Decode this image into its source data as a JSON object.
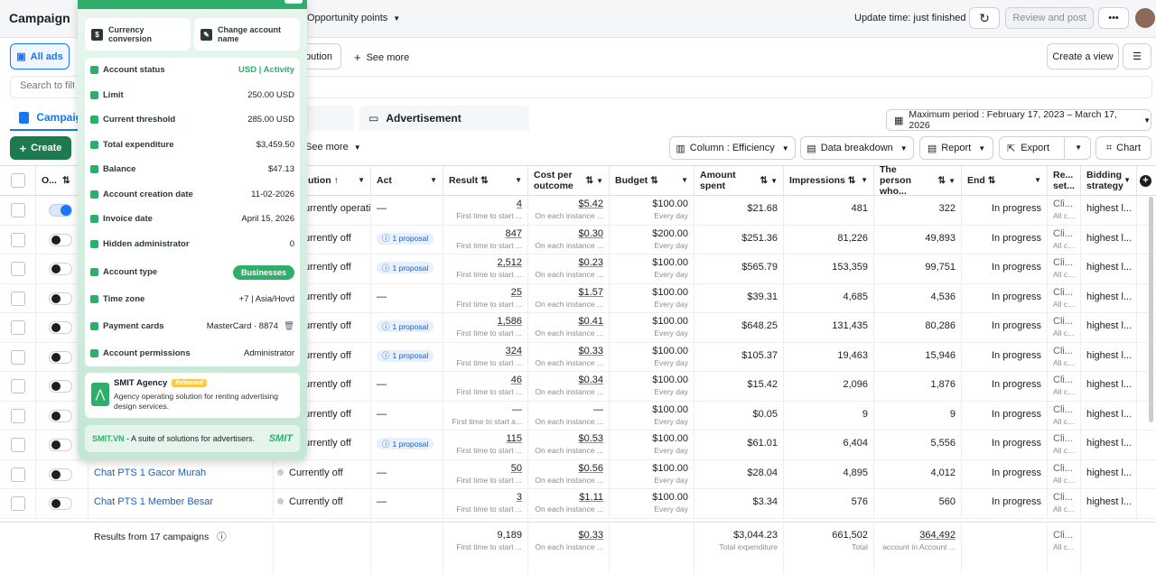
{
  "header": {
    "title": "Campaign",
    "dropdown": "Opportunity points",
    "update_time": "Update time: just finished",
    "review_label": "Review and post"
  },
  "tabs_row": {
    "all_ads": "All ads",
    "distribution_partial": "bution",
    "see_more": "See more",
    "create_view": "Create a view"
  },
  "search": {
    "placeholder": "Search to filte"
  },
  "level_tabs": {
    "campaign": "Campaig",
    "advertisement": "Advertisement"
  },
  "date_range": "Maximum period : February 17, 2023 – March 17, 2026",
  "toolbar": {
    "create": "Create",
    "see_more": "See more",
    "column": "Column : Efficiency",
    "breakdown": "Data breakdown",
    "report": "Report",
    "export": "Export",
    "chart": "Chart"
  },
  "columns": {
    "onoff": "O...",
    "distribution": "ution",
    "act": "Act",
    "result": "Result",
    "cost_per_outcome": "Cost per outcome",
    "budget": "Budget",
    "amount_spent": "Amount spent",
    "impressions": "Impressions",
    "person_who": "The person who...",
    "end": "End",
    "results_set": "Re... set...",
    "bidding": "Bidding strategy"
  },
  "rows": [
    {
      "toggle": "on",
      "status": "urrently operatin",
      "status_dot": "",
      "act": "—",
      "result": "4",
      "cost": "$5.42",
      "budget": "$100.00",
      "spent": "$21.68",
      "impressions": "481",
      "reach": "322",
      "end": "In progress",
      "rs": "Cli...",
      "bid": "highest l..."
    },
    {
      "toggle": "off",
      "status": "urrently off",
      "status_dot": "",
      "act": "1 proposal",
      "result": "847",
      "cost": "$0.30",
      "budget": "$200.00",
      "spent": "$251.36",
      "impressions": "81,226",
      "reach": "49,893",
      "end": "In progress",
      "rs": "Cli...",
      "bid": "highest l..."
    },
    {
      "toggle": "off",
      "status": "urrently off",
      "status_dot": "",
      "act": "1 proposal",
      "result": "2,512",
      "cost": "$0.23",
      "budget": "$100.00",
      "spent": "$565.79",
      "impressions": "153,359",
      "reach": "99,751",
      "end": "In progress",
      "rs": "Cli...",
      "bid": "highest l..."
    },
    {
      "toggle": "off",
      "status": "urrently off",
      "status_dot": "",
      "act": "—",
      "result": "25",
      "cost": "$1.57",
      "budget": "$100.00",
      "spent": "$39.31",
      "impressions": "4,685",
      "reach": "4,536",
      "end": "In progress",
      "rs": "Cli...",
      "bid": "highest l..."
    },
    {
      "toggle": "off",
      "status": "urrently off",
      "status_dot": "",
      "act": "1 proposal",
      "result": "1,586",
      "cost": "$0.41",
      "budget": "$100.00",
      "spent": "$648.25",
      "impressions": "131,435",
      "reach": "80,286",
      "end": "In progress",
      "rs": "Cli...",
      "bid": "highest l..."
    },
    {
      "toggle": "off",
      "status": "urrently off",
      "status_dot": "",
      "act": "1 proposal",
      "result": "324",
      "cost": "$0.33",
      "budget": "$100.00",
      "spent": "$105.37",
      "impressions": "19,463",
      "reach": "15,946",
      "end": "In progress",
      "rs": "Cli...",
      "bid": "highest l..."
    },
    {
      "toggle": "off",
      "status": "urrently off",
      "status_dot": "",
      "act": "—",
      "result": "46",
      "cost": "$0.34",
      "budget": "$100.00",
      "spent": "$15.42",
      "impressions": "2,096",
      "reach": "1,876",
      "end": "In progress",
      "rs": "Cli...",
      "bid": "highest l..."
    },
    {
      "toggle": "off",
      "status": "urrently off",
      "status_dot": "",
      "act": "—",
      "result": "—",
      "cost": "—",
      "budget": "$100.00",
      "spent": "$0.05",
      "impressions": "9",
      "reach": "9",
      "end": "In progress",
      "rs": "Cli...",
      "bid": "highest l..."
    },
    {
      "toggle": "off",
      "status": "urrently off",
      "status_dot": "",
      "act": "1 proposal",
      "result": "115",
      "cost": "$0.53",
      "budget": "$100.00",
      "spent": "$61.01",
      "impressions": "6,404",
      "reach": "5,556",
      "end": "In progress",
      "rs": "Cli...",
      "bid": "highest l..."
    },
    {
      "toggle": "off",
      "name": "Chat PTS 1 Gacor Murah",
      "status": "Currently off",
      "status_dot": "dot",
      "act": "—",
      "result": "50",
      "cost": "$0.56",
      "budget": "$100.00",
      "spent": "$28.04",
      "impressions": "4,895",
      "reach": "4,012",
      "end": "In progress",
      "rs": "Cli...",
      "bid": "highest l..."
    },
    {
      "toggle": "off",
      "name": "Chat PTS 1 Member Besar",
      "status": "Currently off",
      "status_dot": "dot",
      "act": "—",
      "result": "3",
      "cost": "$1.11",
      "budget": "$100.00",
      "spent": "$3.34",
      "impressions": "576",
      "reach": "560",
      "end": "In progress",
      "rs": "Cli...",
      "bid": "highest l..."
    }
  ],
  "row_subs": {
    "result": "First time to start ...",
    "result_alt": "First time to start a...",
    "cost": "On each instance ...",
    "budget": "Every day",
    "rs": "All c..."
  },
  "footer": {
    "label": "Results from 17 campaigns",
    "result": "9,189",
    "result_sub": "First time to start ...",
    "cost": "$0.33",
    "cost_sub": "On each instance ...",
    "spent": "$3,044.23",
    "spent_sub": "Total expenditure",
    "impressions": "661,502",
    "impressions_sub": "Total",
    "reach": "364,492",
    "reach_sub": "account in Account ...",
    "rs": "Cli...",
    "rs_sub": "All c..."
  },
  "panel": {
    "currency_conversion": "Currency conversion",
    "change_account_name": "Change account name",
    "items": [
      {
        "label": "Account status",
        "value": "USD | Activity"
      },
      {
        "label": "Limit",
        "value": "250.00 USD"
      },
      {
        "label": "Current threshold",
        "value": "285.00 USD"
      },
      {
        "label": "Total expenditure",
        "value": "$3,459.50"
      },
      {
        "label": "Balance",
        "value": "$47.13"
      },
      {
        "label": "Account creation date",
        "value": "11-02-2026"
      },
      {
        "label": "Invoice date",
        "value": "April 15, 2026"
      },
      {
        "label": "Hidden administrator",
        "value": "0"
      }
    ],
    "account_type_label": "Account type",
    "account_type_value": "Businesses",
    "time_zone_label": "Time zone",
    "time_zone_value": "+7 | Asia/Hovd",
    "payment_label": "Payment cards",
    "payment_value": "MasterCard · 8874",
    "permissions_label": "Account permissions",
    "permissions_value": "Administrator",
    "agency_name": "SMIT Agency",
    "agency_badge": "Released",
    "agency_desc": "Agency operating solution for renting advertising design services.",
    "footer_site": "SMIT.VN",
    "footer_text": " - A suite of solutions for advertisers.",
    "logo": "SMIT"
  },
  "colors": {
    "accent": "#1877f2",
    "create_green": "#1d7a4e",
    "panel_green": "#2fae6b"
  }
}
